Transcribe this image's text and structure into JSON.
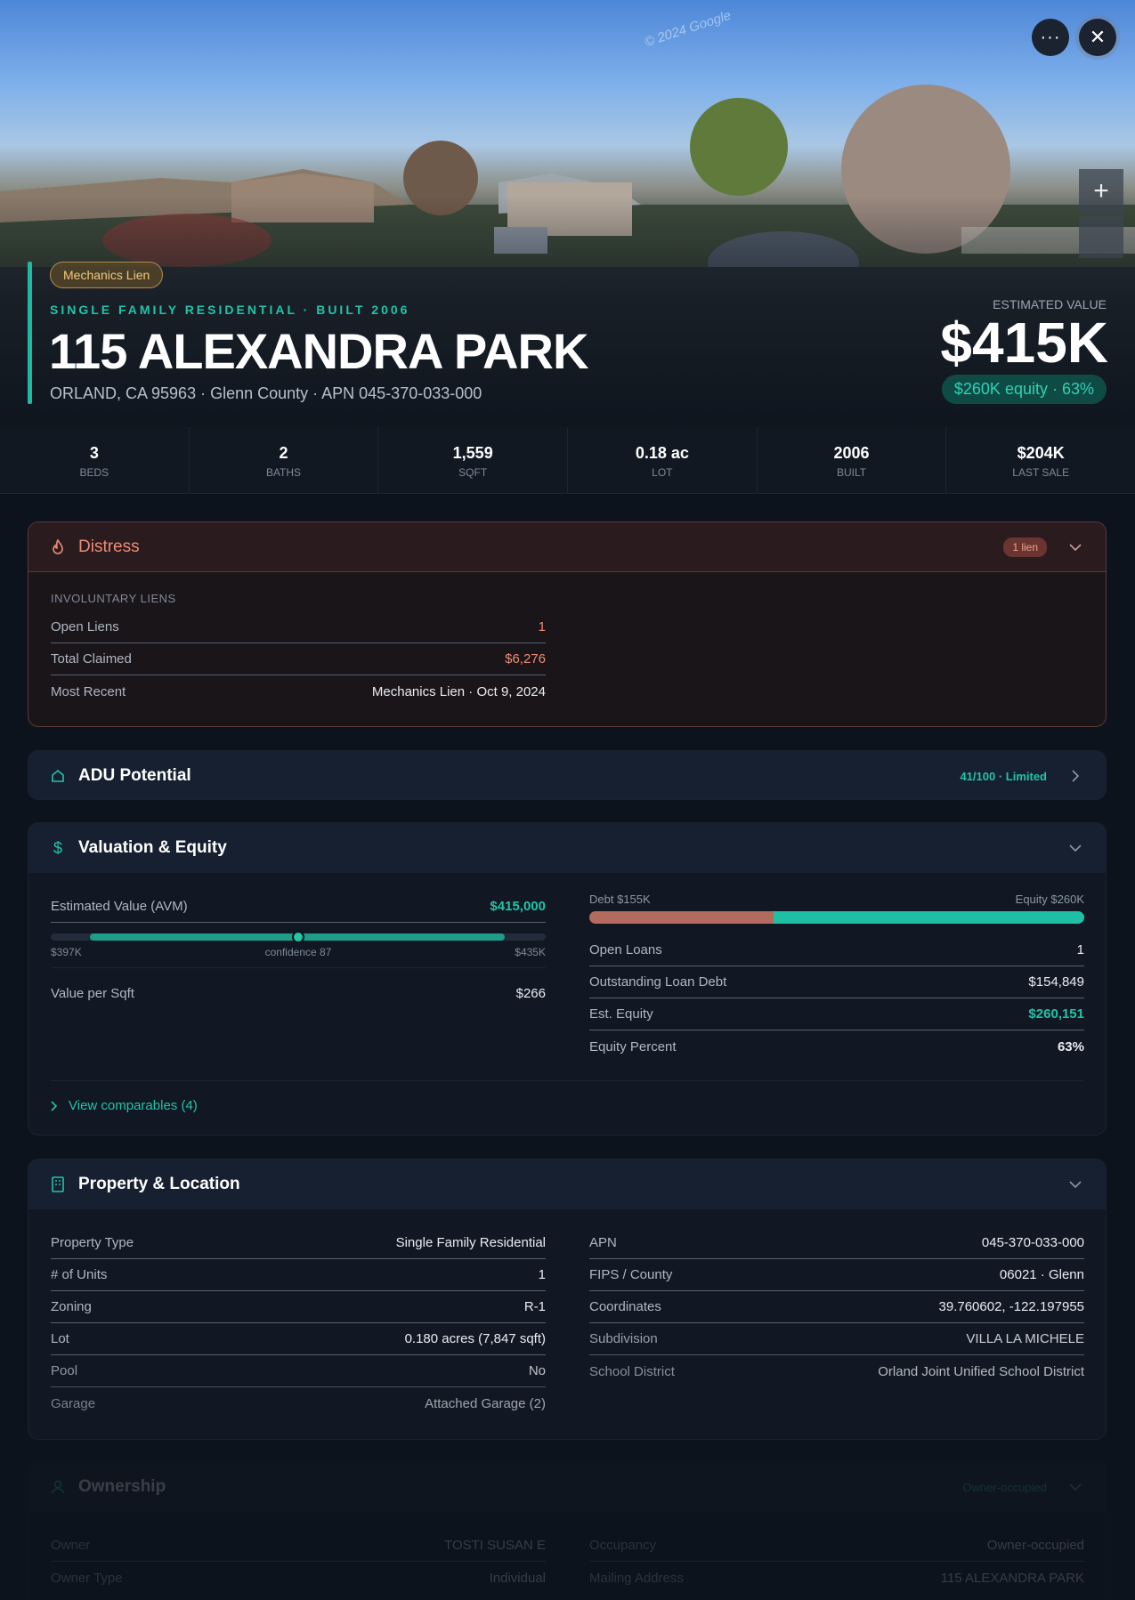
{
  "hero": {
    "watermark": "© 2024 Google",
    "tag": "Mechanics Lien",
    "kicker": "SINGLE FAMILY RESIDENTIAL · BUILT 2006",
    "address": "115 ALEXANDRA PARK",
    "subaddress": "ORLAND, CA 95963 · Glenn County · APN 045-370-033-000",
    "est_label": "ESTIMATED VALUE",
    "est_value": "$415K",
    "equity": "$260K equity · 63%",
    "more_icon": "···",
    "close_icon": "✕",
    "zoom_in": "+"
  },
  "stats": [
    {
      "value": "3",
      "label": "BEDS"
    },
    {
      "value": "2",
      "label": "BATHS"
    },
    {
      "value": "1,559",
      "label": "SQFT"
    },
    {
      "value": "0.18 ac",
      "label": "LOT"
    },
    {
      "value": "2006",
      "label": "BUILT"
    },
    {
      "value": "$204K",
      "label": "LAST SALE"
    }
  ],
  "distress": {
    "title": "Distress",
    "badge": "1 lien",
    "section": "INVOLUNTARY LIENS",
    "rows": [
      {
        "k": "Open Liens",
        "v": "1"
      },
      {
        "k": "Total Claimed",
        "v": "$6,276"
      },
      {
        "k": "Most Recent",
        "v": "Mechanics Lien · Oct 9, 2024"
      }
    ]
  },
  "adu": {
    "title": "ADU Potential",
    "score": "41/100 · Limited"
  },
  "valuation": {
    "title": "Valuation & Equity",
    "avm_label": "Estimated Value (AVM)",
    "avm_value": "$415,000",
    "range_low": "$397K",
    "confidence": "confidence 87",
    "range_high": "$435K",
    "range_fill": {
      "start": 0.08,
      "end": 0.918,
      "point": 0.5
    },
    "vps_label": "Value per Sqft",
    "vps_value": "$266",
    "debt_label": "Debt $155K",
    "equity_label": "Equity $260K",
    "debt_fraction": 0.373,
    "rows": [
      {
        "k": "Open Loans",
        "v": "1"
      },
      {
        "k": "Outstanding Loan Debt",
        "v": "$154,849"
      },
      {
        "k": "Est. Equity",
        "v": "$260,151"
      },
      {
        "k": "Equity Percent",
        "v": "63%"
      }
    ],
    "comparables": "View comparables (4)"
  },
  "property": {
    "title": "Property & Location",
    "left": [
      {
        "k": "Property Type",
        "v": "Single Family Residential"
      },
      {
        "k": "# of Units",
        "v": "1"
      },
      {
        "k": "Zoning",
        "v": "R-1"
      },
      {
        "k": "Lot",
        "v": "0.180 acres (7,847 sqft)"
      },
      {
        "k": "Pool",
        "v": "No"
      },
      {
        "k": "Garage",
        "v": "Attached Garage (2)"
      }
    ],
    "right": [
      {
        "k": "APN",
        "v": "045-370-033-000"
      },
      {
        "k": "FIPS / County",
        "v": "06021 · Glenn"
      },
      {
        "k": "Coordinates",
        "v": "39.760602, -122.197955"
      },
      {
        "k": "Subdivision",
        "v": "VILLA LA MICHELE"
      },
      {
        "k": "School District",
        "v": "Orland Joint Unified School District"
      }
    ]
  },
  "ownership": {
    "title": "Ownership",
    "badge": "Owner-occupied",
    "left": [
      {
        "k": "Owner",
        "v": "TOSTI SUSAN E"
      },
      {
        "k": "Owner Type",
        "v": "Individual"
      }
    ],
    "right": [
      {
        "k": "Occupancy",
        "v": "Owner-occupied"
      },
      {
        "k": "Mailing Address",
        "v": "115 ALEXANDRA PARK"
      }
    ]
  },
  "colors": {
    "accent": "#1fb9a1",
    "distress": "#ef8b75",
    "debt": "#b56a5e",
    "equity": "#1fbfa5"
  }
}
